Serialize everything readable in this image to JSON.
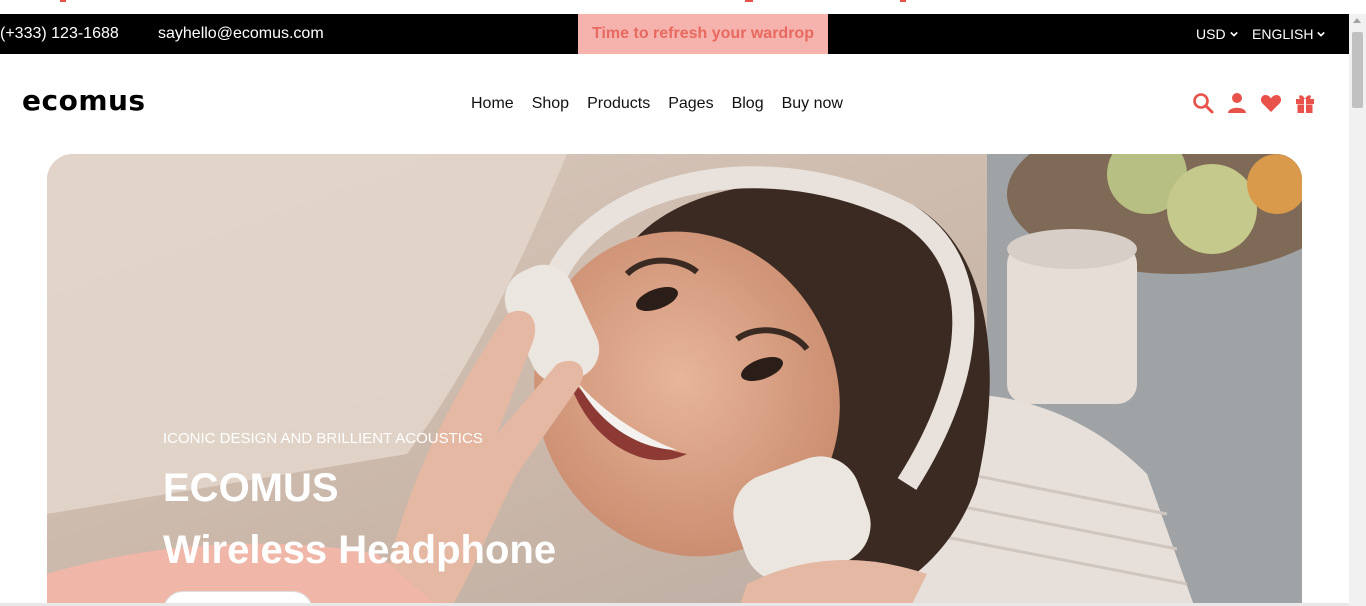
{
  "topbar": {
    "phone": "(+333) 123-1688",
    "email": "sayhello@ecomus.com",
    "promo": "Time to refresh your wardrop",
    "currency": "USD",
    "language": "ENGLISH"
  },
  "header": {
    "logo_text": "ecomus",
    "nav": [
      "Home",
      "Shop",
      "Products",
      "Pages",
      "Blog",
      "Buy now"
    ],
    "icons": [
      "search-icon",
      "user-icon",
      "heart-icon",
      "gift-icon"
    ]
  },
  "hero": {
    "subtitle": "ICONIC DESIGN AND BRILLIENT ACOUSTICS",
    "brand": "ECOMUS",
    "title": "Wireless Headphone"
  },
  "colors": {
    "accent": "#e8524a",
    "promo_bg": "#f6b2ad",
    "promo_text": "#e8695f",
    "topbar_bg": "#000000"
  }
}
